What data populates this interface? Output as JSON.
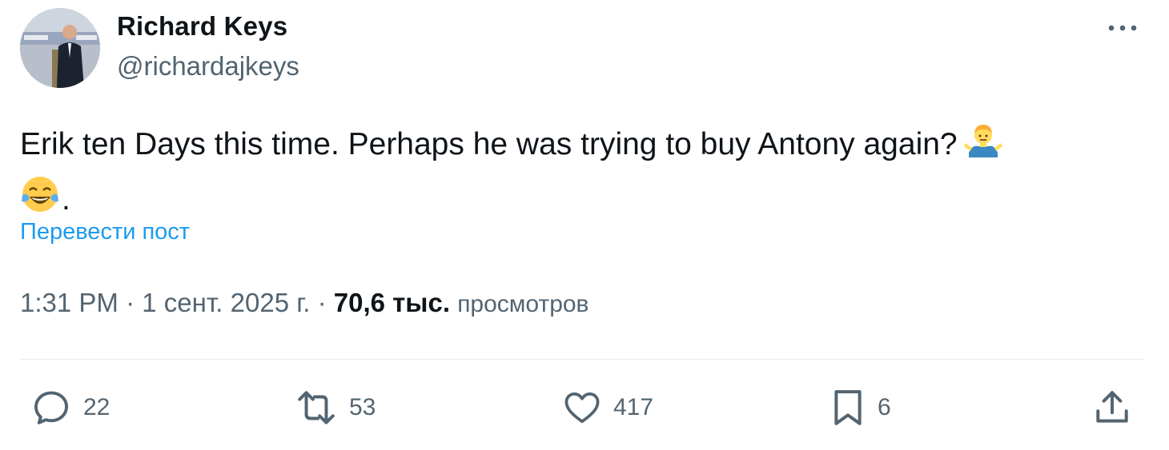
{
  "author": {
    "name": "Richard Keys",
    "handle": "@richardajkeys"
  },
  "tweet": {
    "line1": "Erik ten Days this time. Perhaps he was trying to buy Antony again?",
    "line2_suffix": ".",
    "emojis": [
      "man-shrugging-emoji",
      "face-with-tears-of-joy-emoji"
    ]
  },
  "translate_label": "Перевести пост",
  "meta": {
    "time": "1:31 PM",
    "separator": "·",
    "date": "1 сент. 2025 г.",
    "views_count": "70,6 тыс.",
    "views_label": "просмотров"
  },
  "actions": {
    "replies": "22",
    "reposts": "53",
    "likes": "417",
    "bookmarks": "6"
  },
  "colors": {
    "link": "#1d9bf0",
    "secondary_text": "#536471",
    "primary_text": "#0f1419",
    "divider": "#e7ebee"
  }
}
